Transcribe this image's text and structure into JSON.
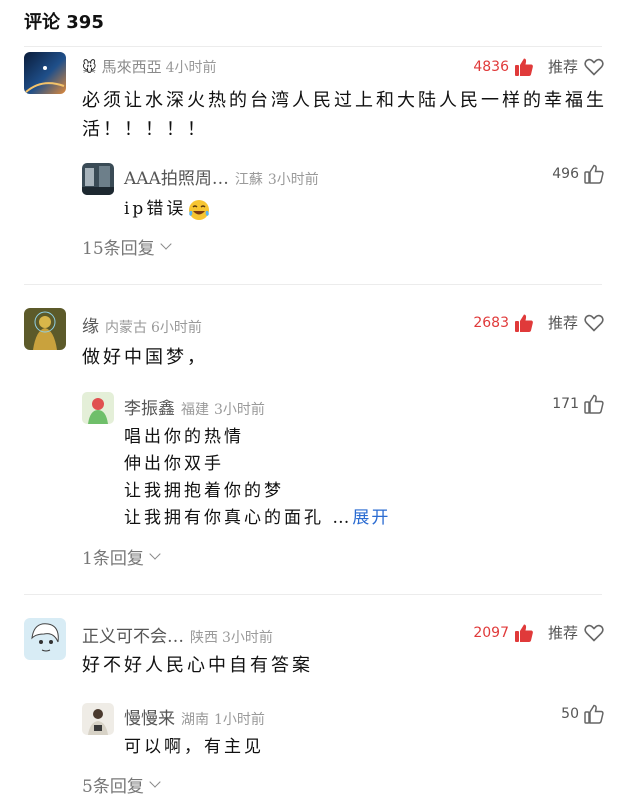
{
  "header": {
    "title": "评论 395"
  },
  "actions": {
    "recommend_label": "推荐",
    "expand_label": "展开"
  },
  "comments": [
    {
      "username": "馬來西亞",
      "time": "4小时前",
      "likes": "4836",
      "text": "必须让水深火热的台湾人民过上和大陆人民一样的幸福生活！！！！！",
      "reply": {
        "username": "AAA拍照周…",
        "location": "江蘇",
        "time": "3小时前",
        "likes": "496",
        "text": "ip错误"
      },
      "reply_count": "15条回复"
    },
    {
      "username": "缘",
      "location": "内蒙古",
      "time": "6小时前",
      "likes": "2683",
      "text": "做好中国梦，",
      "reply": {
        "username": "李振鑫",
        "location": "福建",
        "time": "3小时前",
        "likes": "171",
        "lines": [
          "唱出你的热情",
          "伸出你双手",
          "让我拥抱着你的梦",
          "让我拥有你真心的面孔 …"
        ]
      },
      "reply_count": "1条回复"
    },
    {
      "username": "正义可不会…",
      "location": "陕西",
      "time": "3小时前",
      "likes": "2097",
      "text": "好不好人民心中自有答案",
      "reply": {
        "username": "慢慢来",
        "location": "湖南",
        "time": "1小时前",
        "likes": "50",
        "text": "可以啊，有主见"
      },
      "reply_count": "5条回复"
    }
  ],
  "colors": {
    "like_red": "#e03a3a",
    "link_blue": "#2a6bd1",
    "meta_grey": "#9a9a9a"
  }
}
